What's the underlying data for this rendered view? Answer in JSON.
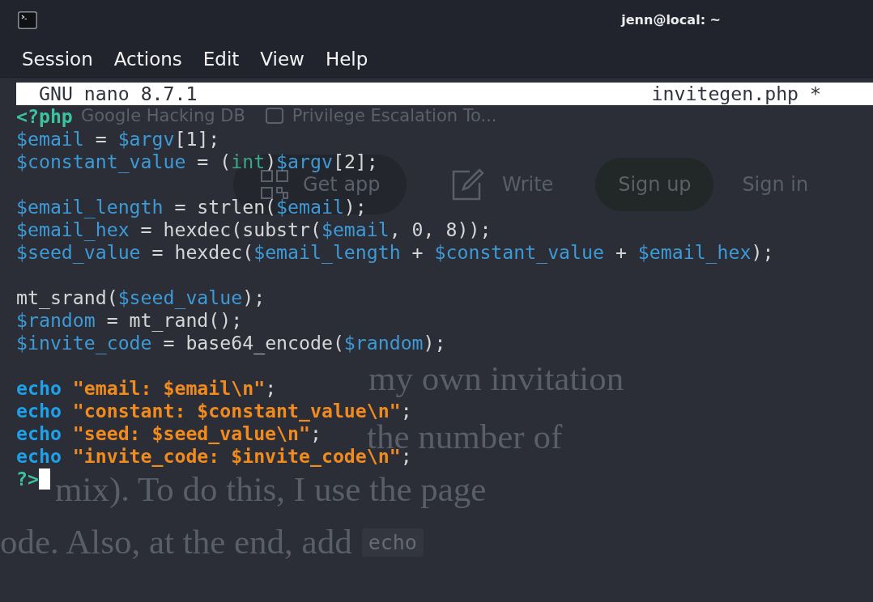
{
  "window": {
    "title": "jenn@local: ~"
  },
  "menu": [
    "Session",
    "Actions",
    "Edit",
    "View",
    "Help"
  ],
  "editor": {
    "version": "GNU nano 8.7.1",
    "filename": "invitegen.php *",
    "lines": [
      {
        "kind": "code",
        "cursor": false,
        "tokens": [
          {
            "text": "<?php",
            "kind": "tag"
          }
        ]
      },
      {
        "kind": "code",
        "cursor": false,
        "tokens": [
          {
            "text": "$email",
            "kind": "var"
          },
          {
            "text": " = ",
            "kind": "plain"
          },
          {
            "text": "$argv",
            "kind": "var"
          },
          {
            "text": "[1];",
            "kind": "plain"
          }
        ]
      },
      {
        "kind": "code",
        "cursor": false,
        "tokens": [
          {
            "text": "$constant_value",
            "kind": "var"
          },
          {
            "text": " = (",
            "kind": "plain"
          },
          {
            "text": "int",
            "kind": "type"
          },
          {
            "text": ")",
            "kind": "plain"
          },
          {
            "text": "$argv",
            "kind": "var"
          },
          {
            "text": "[2];",
            "kind": "plain"
          }
        ]
      },
      {
        "kind": "blank",
        "cursor": false
      },
      {
        "kind": "code",
        "cursor": false,
        "tokens": [
          {
            "text": "$email_length",
            "kind": "var"
          },
          {
            "text": " = strlen(",
            "kind": "plain"
          },
          {
            "text": "$email",
            "kind": "var"
          },
          {
            "text": ");",
            "kind": "plain"
          }
        ]
      },
      {
        "kind": "code",
        "cursor": false,
        "tokens": [
          {
            "text": "$email_hex",
            "kind": "var"
          },
          {
            "text": " = hexdec(substr(",
            "kind": "plain"
          },
          {
            "text": "$email",
            "kind": "var"
          },
          {
            "text": ", 0, 8));",
            "kind": "plain"
          }
        ]
      },
      {
        "kind": "code",
        "cursor": false,
        "tokens": [
          {
            "text": "$seed_value",
            "kind": "var"
          },
          {
            "text": " = hexdec(",
            "kind": "plain"
          },
          {
            "text": "$email_length",
            "kind": "var"
          },
          {
            "text": " + ",
            "kind": "plain"
          },
          {
            "text": "$constant_value",
            "kind": "var"
          },
          {
            "text": " + ",
            "kind": "plain"
          },
          {
            "text": "$email_hex",
            "kind": "var"
          },
          {
            "text": ");",
            "kind": "plain"
          }
        ]
      },
      {
        "kind": "blank",
        "cursor": false
      },
      {
        "kind": "code",
        "cursor": false,
        "tokens": [
          {
            "text": "mt_srand(",
            "kind": "plain"
          },
          {
            "text": "$seed_value",
            "kind": "var"
          },
          {
            "text": ");",
            "kind": "plain"
          }
        ]
      },
      {
        "kind": "code",
        "cursor": false,
        "tokens": [
          {
            "text": "$random",
            "kind": "var"
          },
          {
            "text": " = mt_rand();",
            "kind": "plain"
          }
        ]
      },
      {
        "kind": "code",
        "cursor": false,
        "tokens": [
          {
            "text": "$invite_code",
            "kind": "var"
          },
          {
            "text": " = base64_encode(",
            "kind": "plain"
          },
          {
            "text": "$random",
            "kind": "var"
          },
          {
            "text": ");",
            "kind": "plain"
          }
        ]
      },
      {
        "kind": "blank",
        "cursor": false
      },
      {
        "kind": "code",
        "cursor": false,
        "tokens": [
          {
            "text": "echo",
            "kind": "keyword"
          },
          {
            "text": " \"email: $email\\n\"",
            "kind": "string"
          },
          {
            "text": ";",
            "kind": "plain"
          }
        ]
      },
      {
        "kind": "code",
        "cursor": false,
        "tokens": [
          {
            "text": "echo",
            "kind": "keyword"
          },
          {
            "text": " \"constant: $constant_value\\n\"",
            "kind": "string"
          },
          {
            "text": ";",
            "kind": "plain"
          }
        ]
      },
      {
        "kind": "code",
        "cursor": false,
        "tokens": [
          {
            "text": "echo",
            "kind": "keyword"
          },
          {
            "text": " \"seed: $seed_value\\n\"",
            "kind": "string"
          },
          {
            "text": ";",
            "kind": "plain"
          }
        ]
      },
      {
        "kind": "code",
        "cursor": false,
        "tokens": [
          {
            "text": "echo",
            "kind": "keyword"
          },
          {
            "text": " \"invite_code: $invite_code\\n\"",
            "kind": "string"
          },
          {
            "text": ";",
            "kind": "plain"
          }
        ]
      },
      {
        "kind": "code",
        "cursor": true,
        "tokens": [
          {
            "text": "?>",
            "kind": "tag"
          }
        ]
      }
    ]
  },
  "backdrop": {
    "tabs": [
      {
        "label": "Google Hacking DB",
        "kind": "plain"
      },
      {
        "label": "Privilege Escalation To...",
        "kind": "page"
      }
    ],
    "nav": [
      {
        "label": "Get app",
        "kind": "app_button"
      },
      {
        "label": "Write",
        "kind": "icon_link"
      },
      {
        "label": "Sign up",
        "kind": "pill"
      },
      {
        "label": "Sign in",
        "kind": "link"
      }
    ],
    "paragraph": [
      {
        "text": "my own invitation"
      },
      {
        "text": "the number of"
      },
      {
        "text": "mix). To do this, I use the page"
      },
      {
        "text": "ode. Also, at the end, add",
        "code": "echo"
      }
    ]
  }
}
